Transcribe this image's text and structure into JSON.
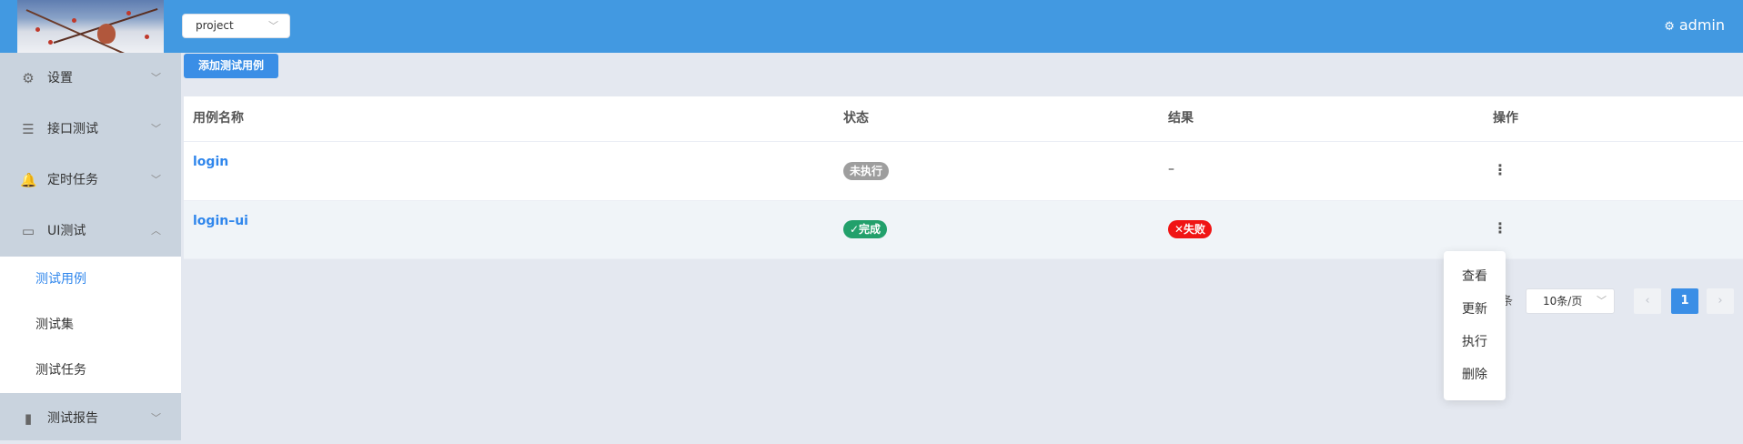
{
  "header": {
    "project_select": "project",
    "user": "admin"
  },
  "sidebar": {
    "items": [
      {
        "label": "设置",
        "icon": "gear-icon"
      },
      {
        "label": "接口测试",
        "icon": "sliders-icon"
      },
      {
        "label": "定时任务",
        "icon": "bell-icon"
      },
      {
        "label": "UI测试",
        "icon": "monitor-icon"
      },
      {
        "label": "测试报告",
        "icon": "bar-chart-icon"
      }
    ],
    "submenu": [
      {
        "label": "测试用例",
        "active": true
      },
      {
        "label": "测试集",
        "active": false
      },
      {
        "label": "测试任务",
        "active": false
      }
    ]
  },
  "main": {
    "add_button": "添加测试用例",
    "columns": [
      "用例名称",
      "状态",
      "结果",
      "操作"
    ],
    "rows": [
      {
        "name": "login",
        "status": "未执行",
        "result": "–"
      },
      {
        "name": "login–ui",
        "status": "✓完成",
        "result": "✕失败"
      }
    ]
  },
  "pagination": {
    "total_suffix": "条",
    "page_size": "10条/页",
    "current_page": "1"
  },
  "row_menu": {
    "items": [
      "查看",
      "更新",
      "执行",
      "删除"
    ]
  },
  "colors": {
    "header": "#4299e1",
    "accent": "#3a8ee6",
    "success": "#22a06b",
    "danger": "#f01414",
    "neutral": "#9e9e9e"
  }
}
